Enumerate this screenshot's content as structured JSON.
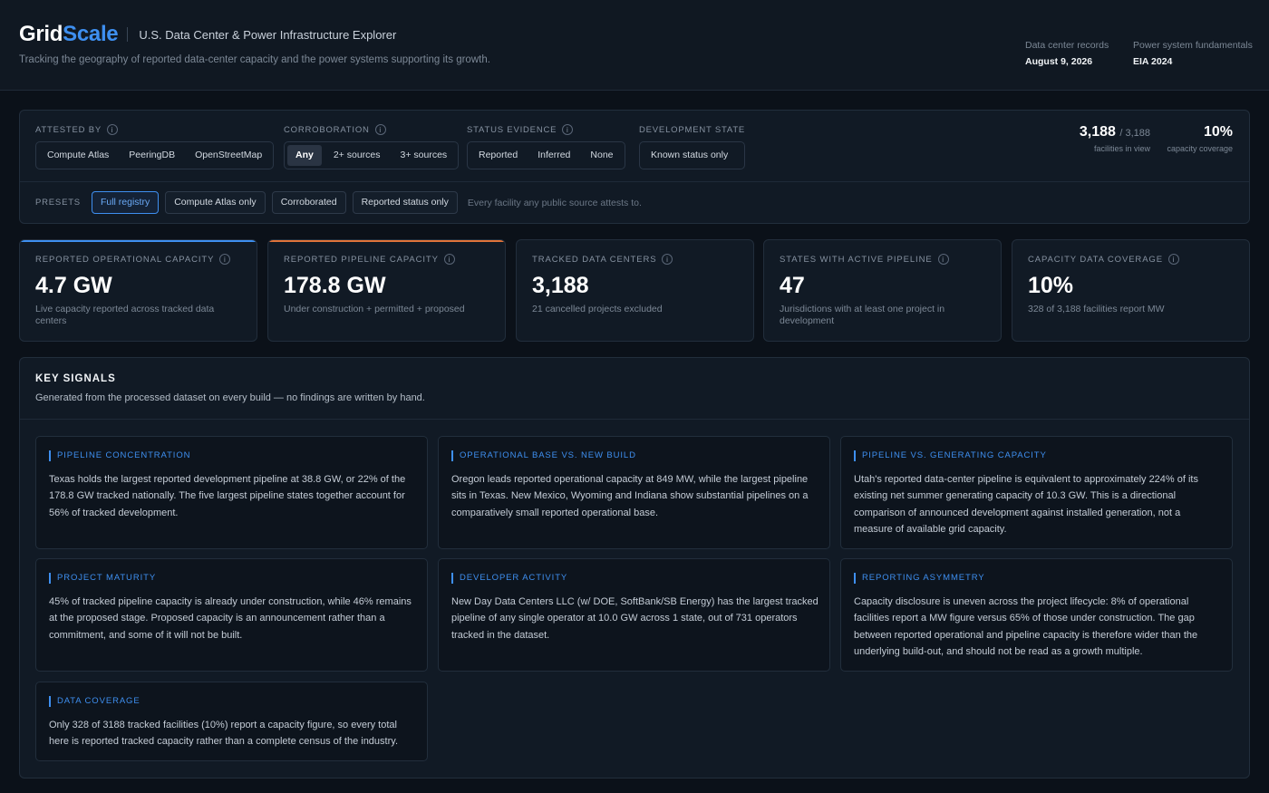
{
  "header": {
    "brand_main": "Grid",
    "brand_accent": "Scale",
    "app_title": "U.S. Data Center & Power Infrastructure Explorer",
    "tagline": "Tracking the geography of reported data-center capacity and the power systems supporting its growth.",
    "meta": [
      {
        "key": "Data center records",
        "value": "August 9, 2026"
      },
      {
        "key": "Power system fundamentals",
        "value": "EIA 2024"
      }
    ]
  },
  "filters": {
    "attested_by": {
      "label": "ATTESTED BY",
      "options": [
        "Compute Atlas",
        "PeeringDB",
        "OpenStreetMap"
      ]
    },
    "corroboration": {
      "label": "CORROBORATION",
      "options": [
        "Any",
        "2+ sources",
        "3+ sources"
      ],
      "selected": "Any"
    },
    "status_evidence": {
      "label": "STATUS EVIDENCE",
      "options": [
        "Reported",
        "Inferred",
        "None"
      ]
    },
    "development_state": {
      "label": "DEVELOPMENT STATE",
      "options": [
        "Known status only"
      ]
    },
    "presets": {
      "label": "PRESETS",
      "options": [
        "Full registry",
        "Compute Atlas only",
        "Corroborated",
        "Reported status only"
      ],
      "selected": "Full registry",
      "note": "Every facility any public source attests to."
    },
    "facilities_in_view": {
      "count": "3,188",
      "total": "/ 3,188",
      "label": "facilities in view"
    },
    "capacity_coverage": {
      "value": "10%",
      "label": "capacity coverage"
    }
  },
  "kpis": [
    {
      "label": "REPORTED OPERATIONAL CAPACITY",
      "value": "4.7 GW",
      "sub": "Live capacity reported across tracked data centers",
      "accent": "#3e8ff0"
    },
    {
      "label": "REPORTED PIPELINE CAPACITY",
      "value": "178.8 GW",
      "sub": "Under construction + permitted + proposed",
      "accent": "#e0733a"
    },
    {
      "label": "TRACKED DATA CENTERS",
      "value": "3,188",
      "sub": "21 cancelled projects excluded"
    },
    {
      "label": "STATES WITH ACTIVE PIPELINE",
      "value": "47",
      "sub": "Jurisdictions with at least one project in development"
    },
    {
      "label": "CAPACITY DATA COVERAGE",
      "value": "10%",
      "sub": "328 of 3,188 facilities report MW"
    }
  ],
  "signals": {
    "title": "KEY SIGNALS",
    "subtitle": "Generated from the processed dataset on every build — no findings are written by hand.",
    "cards": [
      {
        "heading": "PIPELINE CONCENTRATION",
        "body": "Texas holds the largest reported development pipeline at 38.8 GW, or 22% of the 178.8 GW tracked nationally. The five largest pipeline states together account for 56% of tracked development."
      },
      {
        "heading": "OPERATIONAL BASE VS. NEW BUILD",
        "body": "Oregon leads reported operational capacity at 849 MW, while the largest pipeline sits in Texas. New Mexico, Wyoming and Indiana show substantial pipelines on a comparatively small reported operational base."
      },
      {
        "heading": "PIPELINE VS. GENERATING CAPACITY",
        "body": "Utah's reported data-center pipeline is equivalent to approximately 224% of its existing net summer generating capacity of 10.3 GW. This is a directional comparison of announced development against installed generation, not a measure of available grid capacity."
      },
      {
        "heading": "PROJECT MATURITY",
        "body": "45% of tracked pipeline capacity is already under construction, while 46% remains at the proposed stage. Proposed capacity is an announcement rather than a commitment, and some of it will not be built."
      },
      {
        "heading": "DEVELOPER ACTIVITY",
        "body": "New Day Data Centers LLC (w/ DOE, SoftBank/SB Energy) has the largest tracked pipeline of any single operator at 10.0 GW across 1 state, out of 731 operators tracked in the dataset."
      },
      {
        "heading": "REPORTING ASYMMETRY",
        "body": "Capacity disclosure is uneven across the project lifecycle: 8% of operational facilities report a MW figure versus 65% of those under construction. The gap between reported operational and pipeline capacity is therefore wider than the underlying build-out, and should not be read as a growth multiple."
      },
      {
        "heading": "DATA COVERAGE",
        "body": "Only 328 of 3188 tracked facilities (10%) report a capacity figure, so every total here is reported tracked capacity rather than a complete census of the industry."
      }
    ]
  }
}
